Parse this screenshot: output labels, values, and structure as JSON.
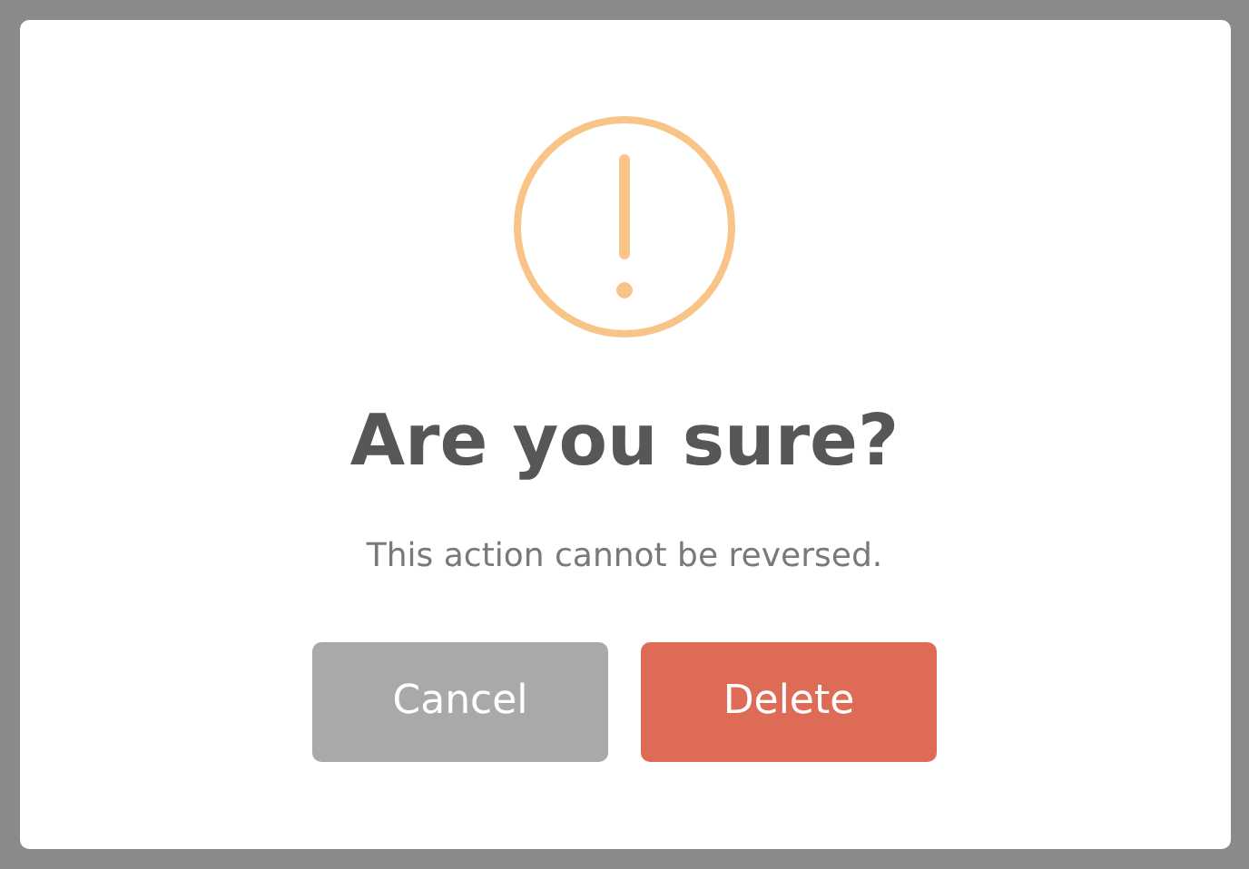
{
  "dialog": {
    "title": "Are you sure?",
    "message": "This action cannot be reversed.",
    "buttons": [
      {
        "label": "Cancel",
        "kind": "cancel"
      },
      {
        "label": "Delete",
        "kind": "confirm"
      }
    ]
  }
}
